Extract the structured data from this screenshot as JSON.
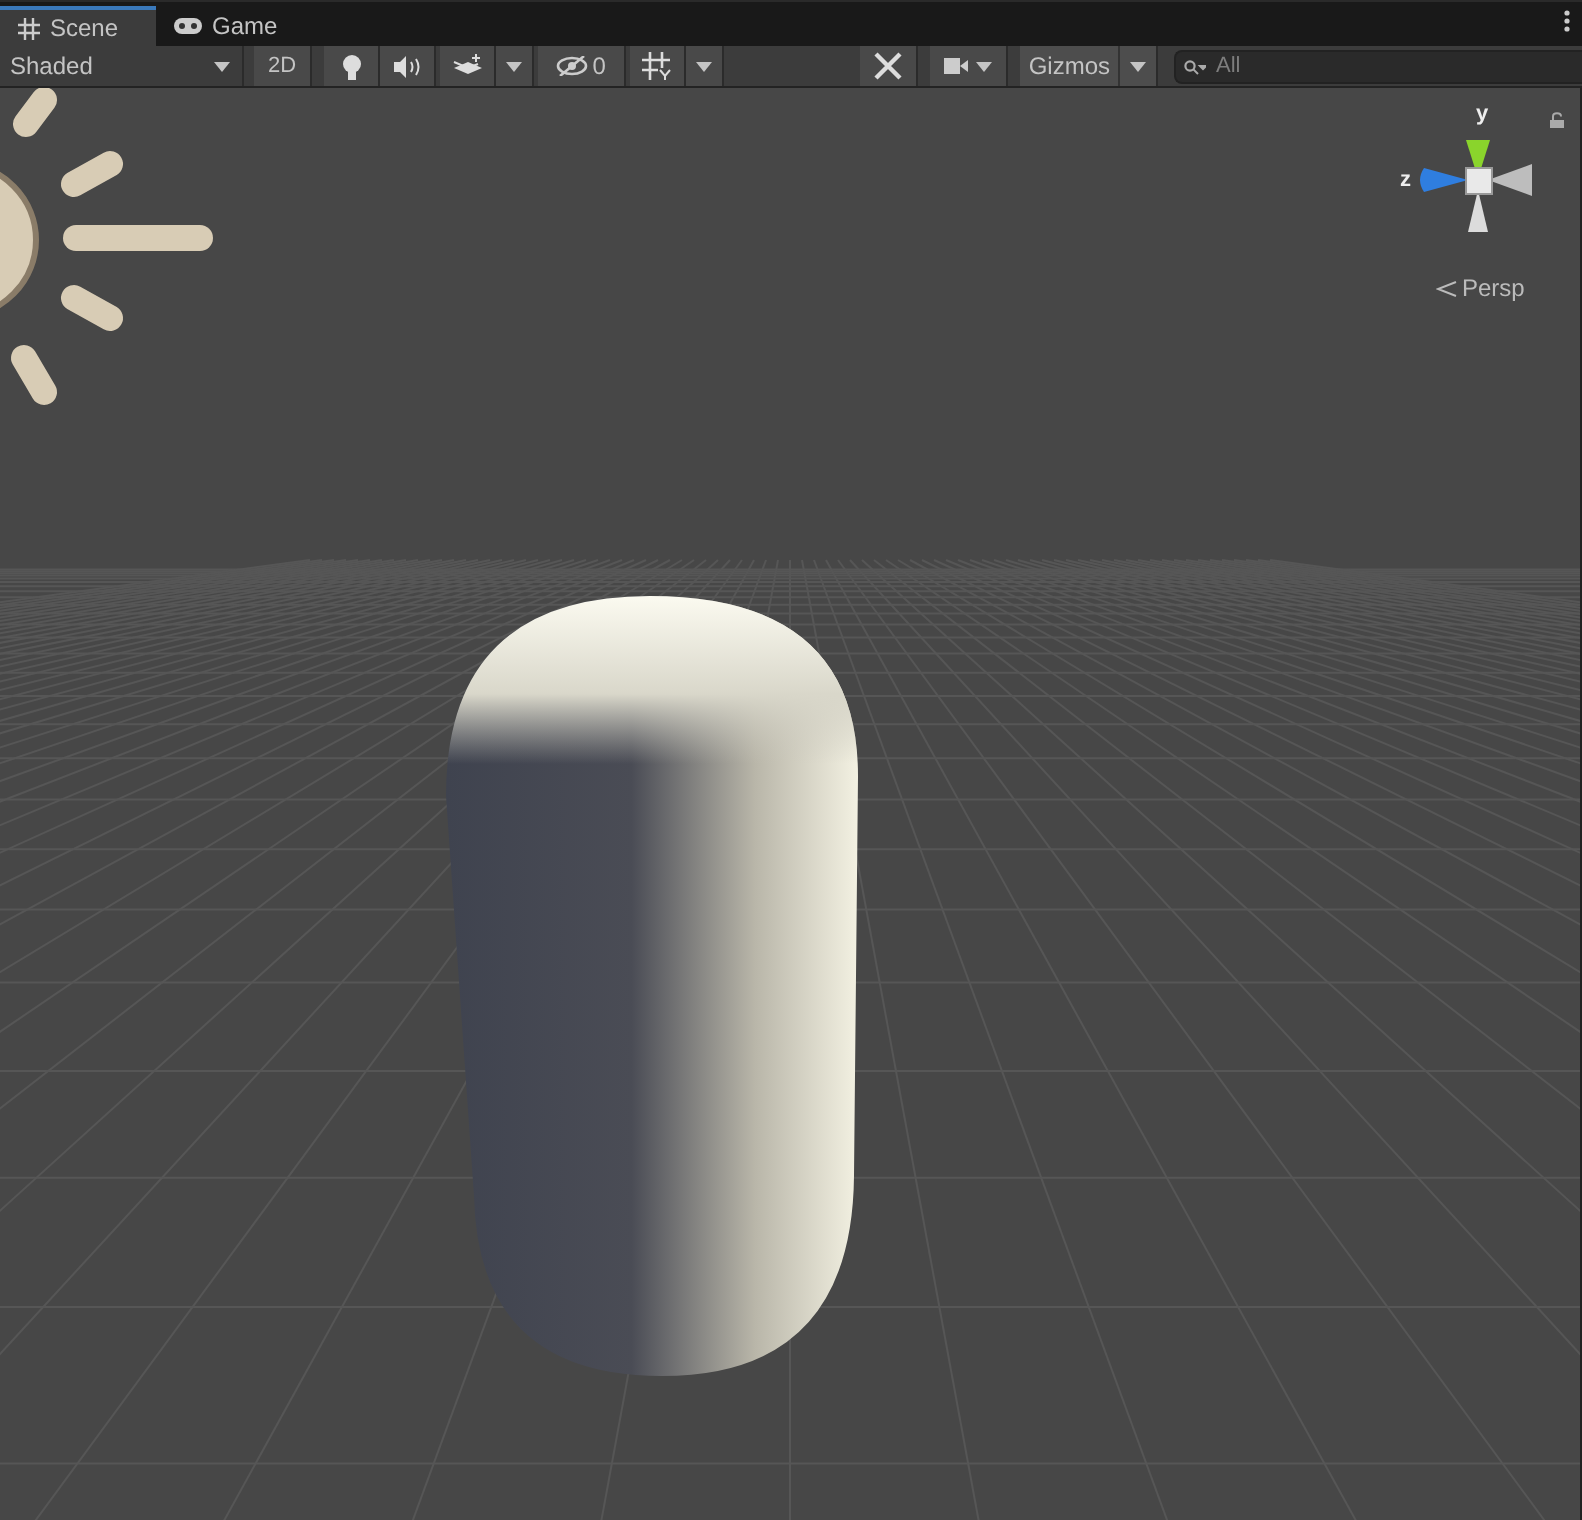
{
  "tabs": [
    {
      "label": "Scene",
      "selected": true
    },
    {
      "label": "Game",
      "selected": false
    }
  ],
  "toolbar": {
    "draw_mode": "Shaded",
    "mode_2d": "2D",
    "hidden_count": "0",
    "gizmos": "Gizmos",
    "search": {
      "placeholder": "All"
    }
  },
  "orientation_gizmo": {
    "y_label": "y",
    "z_label": "z",
    "projection": "Persp"
  }
}
